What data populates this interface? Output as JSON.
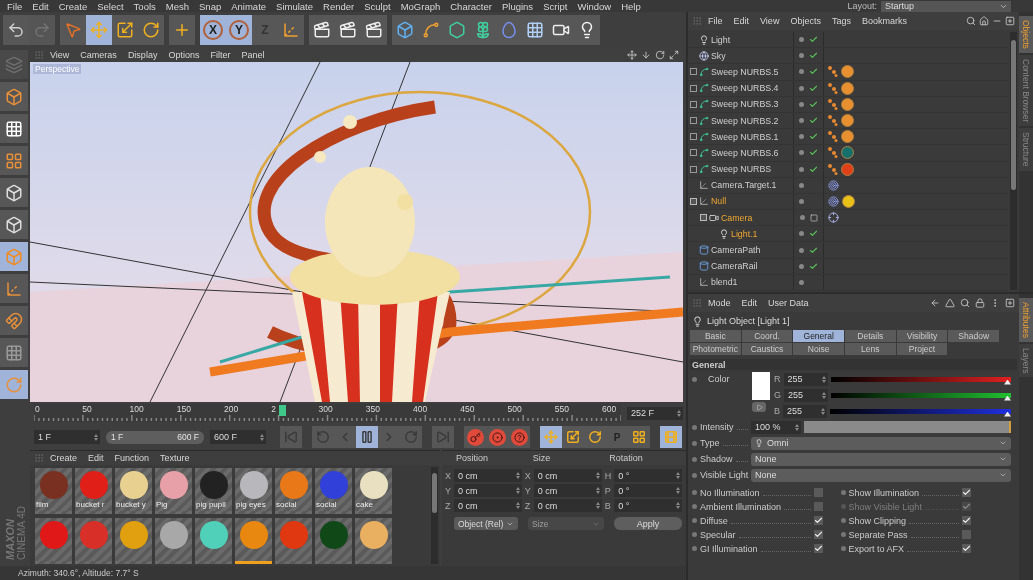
{
  "menu_bar": {
    "items": [
      "File",
      "Edit",
      "Create",
      "Select",
      "Tools",
      "Mesh",
      "Snap",
      "Animate",
      "Simulate",
      "Render",
      "Sculpt",
      "MoGraph",
      "Character",
      "Plugins",
      "Script",
      "Window",
      "Help"
    ],
    "layout_label": "Layout:",
    "layout_value": "Startup"
  },
  "toolbar": [
    [
      {
        "kind": "undo",
        "selected": false,
        "disabled": false
      },
      {
        "kind": "redo",
        "selected": false,
        "disabled": true
      }
    ],
    [
      {
        "kind": "select",
        "selected": false,
        "disabled": false
      },
      {
        "kind": "move",
        "selected": true,
        "disabled": false
      },
      {
        "kind": "scale",
        "selected": false,
        "disabled": false
      },
      {
        "kind": "rotate",
        "selected": false,
        "disabled": false
      }
    ],
    [
      {
        "kind": "add",
        "selected": false,
        "disabled": false
      }
    ],
    [
      {
        "kind": "axis",
        "label": "X",
        "selected": true,
        "disabled": false
      },
      {
        "kind": "axis",
        "label": "Y",
        "selected": true,
        "disabled": false
      },
      {
        "kind": "axis",
        "label": "Z",
        "selected": false,
        "disabled": false
      },
      {
        "kind": "coord",
        "selected": false,
        "disabled": false
      }
    ],
    [
      {
        "kind": "render",
        "selected": false,
        "disabled": false
      },
      {
        "kind": "render",
        "selected": false,
        "disabled": false
      },
      {
        "kind": "render",
        "selected": false,
        "disabled": false
      }
    ],
    [
      {
        "kind": "cube",
        "selected": false,
        "disabled": false
      },
      {
        "kind": "pen",
        "selected": false,
        "disabled": false
      },
      {
        "kind": "subdivision",
        "selected": false,
        "disabled": false
      },
      {
        "kind": "cloner",
        "selected": false,
        "disabled": false
      },
      {
        "kind": "deformer",
        "selected": false,
        "disabled": false
      },
      {
        "kind": "floor",
        "selected": false,
        "disabled": false
      },
      {
        "kind": "camera",
        "selected": false,
        "disabled": false
      },
      {
        "kind": "light",
        "selected": false,
        "disabled": false
      }
    ]
  ],
  "left_toolbar": [
    {
      "kind": "texture",
      "selected": false,
      "disabled": true
    },
    {
      "kind": "model",
      "selected": false,
      "disabled": false
    },
    {
      "kind": "checker",
      "selected": false,
      "disabled": false
    },
    {
      "kind": "workplane",
      "selected": false,
      "disabled": false
    },
    {
      "kind": "points",
      "selected": false,
      "disabled": false
    },
    {
      "kind": "edges",
      "selected": false,
      "disabled": false
    },
    {
      "kind": "polygons",
      "selected": true,
      "disabled": false
    },
    {
      "kind": "axis",
      "selected": false,
      "disabled": false
    },
    {
      "kind": "magnet",
      "selected": false,
      "disabled": false
    },
    {
      "kind": "lock",
      "selected": false,
      "disabled": false
    },
    {
      "kind": "planar",
      "selected": true,
      "disabled": false
    }
  ],
  "viewport": {
    "menu": [
      "View",
      "Cameras",
      "Display",
      "Options",
      "Filter",
      "Panel"
    ],
    "camera": "Perspective"
  },
  "timeline": {
    "tick_labels": [
      "0",
      "50",
      "100",
      "150",
      "200",
      "2",
      "300",
      "350",
      "400",
      "450",
      "500",
      "550",
      "600"
    ],
    "playhead": {
      "level": 0.42
    },
    "current_frame": "252 F"
  },
  "playback": {
    "start": "1 F",
    "range_start": "1 F",
    "range_end": "600 F",
    "end": "600 F",
    "groups": [
      [
        {
          "kind": "go_start",
          "selected": false
        }
      ],
      [
        {
          "kind": "loop",
          "selected": false
        },
        {
          "kind": "prev",
          "selected": false
        },
        {
          "kind": "pause",
          "selected": true
        },
        {
          "kind": "next",
          "selected": false
        },
        {
          "kind": "cycle",
          "selected": false
        }
      ],
      [
        {
          "kind": "go_end",
          "selected": false
        }
      ],
      [
        {
          "kind": "record",
          "selected": false
        },
        {
          "kind": "autokey",
          "selected": false
        },
        {
          "kind": "keyhelp",
          "selected": false
        }
      ],
      [
        {
          "kind": "move",
          "selected": true
        },
        {
          "kind": "scale",
          "selected": false
        },
        {
          "kind": "rotate",
          "selected": false
        },
        {
          "kind": "param",
          "label": "P",
          "selected": false
        },
        {
          "kind": "points",
          "selected": false
        }
      ],
      [
        {
          "kind": "timeline",
          "selected": true
        }
      ]
    ]
  },
  "material_manager": {
    "menu": [
      "Create",
      "Edit",
      "Function",
      "Texture"
    ],
    "materials": [
      {
        "name": "film",
        "color": "#7a3020",
        "selected": false
      },
      {
        "name": "bucket r",
        "color": "#e02018",
        "selected": false
      },
      {
        "name": "bucket y",
        "color": "#e8d090",
        "selected": false
      },
      {
        "name": "Pig",
        "color": "#e8a0a8",
        "selected": false
      },
      {
        "name": "pig pupil",
        "color": "#222222",
        "selected": false
      },
      {
        "name": "pig eyes",
        "color": "#b8b8bc",
        "selected": false
      },
      {
        "name": "social",
        "color": "#e87818",
        "selected": false
      },
      {
        "name": "social",
        "color": "#3040d8",
        "selected": false
      },
      {
        "name": "cake",
        "color": "#e8e0c0",
        "selected": false
      },
      {
        "color": "#e01818",
        "selected": false
      },
      {
        "color": "#d83028",
        "selected": false
      },
      {
        "color": "#e0a010",
        "selected": false
      },
      {
        "color": "#a8a8a8",
        "selected": false
      },
      {
        "color": "#50d0b8",
        "selected": false
      },
      {
        "color": "#e88810",
        "selected": true
      },
      {
        "color": "#e03810",
        "selected": false
      },
      {
        "color": "#104818",
        "selected": false
      },
      {
        "color": "#e8b060",
        "selected": false
      }
    ]
  },
  "coordinates": {
    "headers": [
      "Position",
      "Size",
      "Rotation"
    ],
    "rows": [
      [
        {
          "axis": "X",
          "value": "0 cm"
        },
        {
          "axis": "X",
          "value": "0 cm"
        },
        {
          "axis": "H",
          "value": "0 °"
        }
      ],
      [
        {
          "axis": "Y",
          "value": "0 cm"
        },
        {
          "axis": "Y",
          "value": "0 cm"
        },
        {
          "axis": "P",
          "value": "0 °"
        }
      ],
      [
        {
          "axis": "Z",
          "value": "0 cm"
        },
        {
          "axis": "Z",
          "value": "0 cm"
        },
        {
          "axis": "B",
          "value": "0 °"
        }
      ]
    ],
    "mode": {
      "label": "Object (Rel)",
      "disabled": false
    },
    "size_mode": {
      "label": "Size",
      "disabled": true
    },
    "apply": "Apply"
  },
  "logo": {
    "brand": "MAXON",
    "product": "CINEMA 4D"
  },
  "status_bar": "Azimuth: 340.6°, Altitude: 7.7° S",
  "object_manager": {
    "menu": [
      "File",
      "Edit",
      "View",
      "Objects",
      "Tags",
      "Bookmarks"
    ],
    "objects": [
      {
        "name": "Light",
        "kind": "light",
        "selected": false,
        "enabled": true
      },
      {
        "name": "Sky",
        "kind": "sky",
        "selected": false,
        "enabled": true
      },
      {
        "name": "Sweep NURBS.5",
        "kind": "sweep",
        "expanded": false,
        "selected": false,
        "enabled": true,
        "tags": [
          {
            "kind": "phong"
          },
          {
            "kind": "material",
            "color": "#e89030"
          }
        ]
      },
      {
        "name": "Sweep NURBS.4",
        "kind": "sweep",
        "expanded": false,
        "selected": false,
        "enabled": true,
        "tags": [
          {
            "kind": "phong"
          },
          {
            "kind": "material",
            "color": "#e89030"
          }
        ]
      },
      {
        "name": "Sweep NURBS.3",
        "kind": "sweep",
        "expanded": false,
        "selected": false,
        "enabled": true,
        "tags": [
          {
            "kind": "phong"
          },
          {
            "kind": "material",
            "color": "#e89030"
          }
        ]
      },
      {
        "name": "Sweep NURBS.2",
        "kind": "sweep",
        "expanded": false,
        "selected": false,
        "enabled": true,
        "tags": [
          {
            "kind": "phong"
          },
          {
            "kind": "material",
            "color": "#e89030"
          }
        ]
      },
      {
        "name": "Sweep NURBS.1",
        "kind": "sweep",
        "expanded": false,
        "selected": false,
        "enabled": true,
        "tags": [
          {
            "kind": "phong"
          },
          {
            "kind": "material",
            "color": "#e89030"
          }
        ]
      },
      {
        "name": "Sweep NURBS.6",
        "kind": "sweep",
        "expanded": false,
        "selected": false,
        "enabled": true,
        "tags": [
          {
            "kind": "phong"
          },
          {
            "kind": "material",
            "color": "#18706c"
          }
        ]
      },
      {
        "name": "Sweep NURBS",
        "kind": "sweep",
        "expanded": false,
        "selected": false,
        "enabled": true,
        "tags": [
          {
            "kind": "phong"
          },
          {
            "kind": "material",
            "color": "#e04018"
          }
        ]
      },
      {
        "name": "Camera.Target.1",
        "kind": "null",
        "selected": false,
        "enabled": false,
        "tags": [
          {
            "kind": "target"
          }
        ]
      },
      {
        "name": "Null",
        "kind": "null",
        "expanded": true,
        "selected": true,
        "enabled": false,
        "tags": [
          {
            "kind": "target"
          },
          {
            "kind": "material",
            "color": "#e8c018"
          }
        ],
        "children": [
          {
            "name": "Camera",
            "kind": "camera",
            "expanded": true,
            "selected": true,
            "enabled": false,
            "tags": [
              {
                "kind": "protection"
              }
            ],
            "children": [
              {
                "name": "Light.1",
                "kind": "light",
                "selected": true,
                "enabled": true
              }
            ]
          }
        ]
      },
      {
        "name": "CameraPath",
        "kind": "spline",
        "selected": false,
        "enabled": true
      },
      {
        "name": "CameraRail",
        "kind": "spline",
        "selected": false,
        "enabled": true
      },
      {
        "name": "blend1",
        "kind": "null",
        "selected": false,
        "enabled": false
      }
    ]
  },
  "object_side_tabs": [
    {
      "label": "Objects",
      "selected": true
    },
    {
      "label": "Content Browser",
      "selected": false
    },
    {
      "label": "Structure",
      "selected": false
    }
  ],
  "attribute_manager": {
    "menu": [
      "Mode",
      "Edit",
      "User Data"
    ],
    "title": "Light Object [Light 1]",
    "tabs": [
      {
        "label": "Basic",
        "selected": false
      },
      {
        "label": "Coord.",
        "selected": false
      },
      {
        "label": "General",
        "selected": true
      },
      {
        "label": "Details",
        "selected": false
      },
      {
        "label": "Visibility",
        "selected": false
      },
      {
        "label": "Shadow",
        "selected": false
      },
      {
        "label": "Photometric",
        "selected": false
      },
      {
        "label": "Caustics",
        "selected": false
      },
      {
        "label": "Noise",
        "selected": false
      },
      {
        "label": "Lens",
        "selected": false
      },
      {
        "label": "Project",
        "selected": false
      }
    ],
    "section": "General",
    "color": {
      "label": "Color",
      "channels": [
        {
          "name": "R",
          "value": "255",
          "level": 1,
          "color": "#e02020"
        },
        {
          "name": "G",
          "value": "255",
          "level": 1,
          "color": "#20c030"
        },
        {
          "name": "B",
          "value": "255",
          "level": 1,
          "color": "#2030e0"
        }
      ]
    },
    "intensity": {
      "label": "Intensity",
      "value": "100 %",
      "level": 1
    },
    "dropdowns": [
      {
        "label": "Type",
        "value": "Omni",
        "kind": "light"
      },
      {
        "label": "Shadow",
        "value": "None",
        "kind": "plain"
      },
      {
        "label": "Visible Light",
        "value": "None",
        "kind": "plain"
      }
    ],
    "options": [
      {
        "label": "No Illumination",
        "checked": false,
        "disabled": false
      },
      {
        "label": "Show Illumination",
        "checked": true,
        "disabled": false
      },
      {
        "label": "Ambient Illumination",
        "checked": false,
        "disabled": false
      },
      {
        "label": "Show Visible Light",
        "checked": true,
        "disabled": true
      },
      {
        "label": "Diffuse",
        "checked": true,
        "disabled": false
      },
      {
        "label": "Show Clipping",
        "checked": true,
        "disabled": false
      },
      {
        "label": "Specular",
        "checked": true,
        "disabled": false
      },
      {
        "label": "Separate Pass",
        "checked": false,
        "disabled": false
      },
      {
        "label": "GI Illumination",
        "checked": true,
        "disabled": false
      },
      {
        "label": "Export to AFX",
        "checked": true,
        "disabled": false
      }
    ]
  },
  "attribute_side_tabs": [
    {
      "label": "Attributes",
      "selected": true
    },
    {
      "label": "Layers",
      "selected": false
    }
  ]
}
